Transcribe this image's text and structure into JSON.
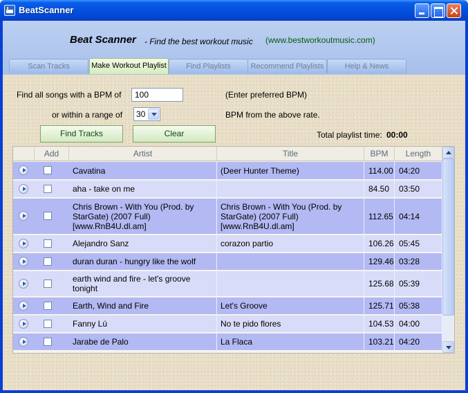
{
  "window": {
    "title": "BeatScanner"
  },
  "header": {
    "title": "Beat Scanner",
    "subtitle": "- Find the best workout music",
    "url": "(www.bestworkoutmusic.com)"
  },
  "tabs": [
    {
      "label": "Scan Tracks",
      "active": false
    },
    {
      "label": "Make Workout Playlist",
      "active": true
    },
    {
      "label": "Find Playlists",
      "active": false
    },
    {
      "label": "Recommend Playlists",
      "active": false
    },
    {
      "label": "Help & News",
      "active": false
    }
  ],
  "form": {
    "bpm_label": "Find all songs with a BPM of",
    "bpm_value": "100",
    "bpm_hint": "(Enter preferred BPM)",
    "range_label": "or within a range of",
    "range_value": "30",
    "range_hint": "BPM from the above rate.",
    "find_label": "Find Tracks",
    "clear_label": "Clear",
    "total_label": "Total playlist time:",
    "total_value": "00:00"
  },
  "table": {
    "columns": [
      "Add",
      "Artist",
      "Title",
      "BPM",
      "Length"
    ],
    "rows": [
      {
        "artist": "Cavatina",
        "title": "(Deer Hunter Theme)",
        "bpm": "114.00",
        "length": "04:20"
      },
      {
        "artist": "aha - take on me",
        "title": "",
        "bpm": "84.50",
        "length": "03:50"
      },
      {
        "artist": "Chris Brown - With You (Prod. by StarGate) (2007 Full) [www.RnB4U.dl.am]",
        "title": "Chris Brown - With You (Prod. by StarGate) (2007 Full) [www.RnB4U.dl.am]",
        "bpm": "112.65",
        "length": "04:14"
      },
      {
        "artist": "Alejandro Sanz",
        "title": "corazon partio",
        "bpm": "106.26",
        "length": "05:45"
      },
      {
        "artist": "duran duran - hungry like the wolf",
        "title": "",
        "bpm": "129.46",
        "length": "03:28"
      },
      {
        "artist": "earth wind and fire - let's groove tonight",
        "title": "",
        "bpm": "125.68",
        "length": "05:39"
      },
      {
        "artist": "Earth, Wind and Fire",
        "title": "Let's Groove",
        "bpm": "125.71",
        "length": "05:38"
      },
      {
        "artist": "Fanny Lú",
        "title": "No te pido flores",
        "bpm": "104.53",
        "length": "04:00"
      },
      {
        "artist": "Jarabe de Palo",
        "title": "La Flaca",
        "bpm": "103.21",
        "length": "04:20"
      }
    ]
  },
  "colors": {
    "row_odd": "#b3b9f2",
    "row_even": "#d9dcf8",
    "header_band": "#a7bfea",
    "url_green": "#0a5a0a"
  }
}
